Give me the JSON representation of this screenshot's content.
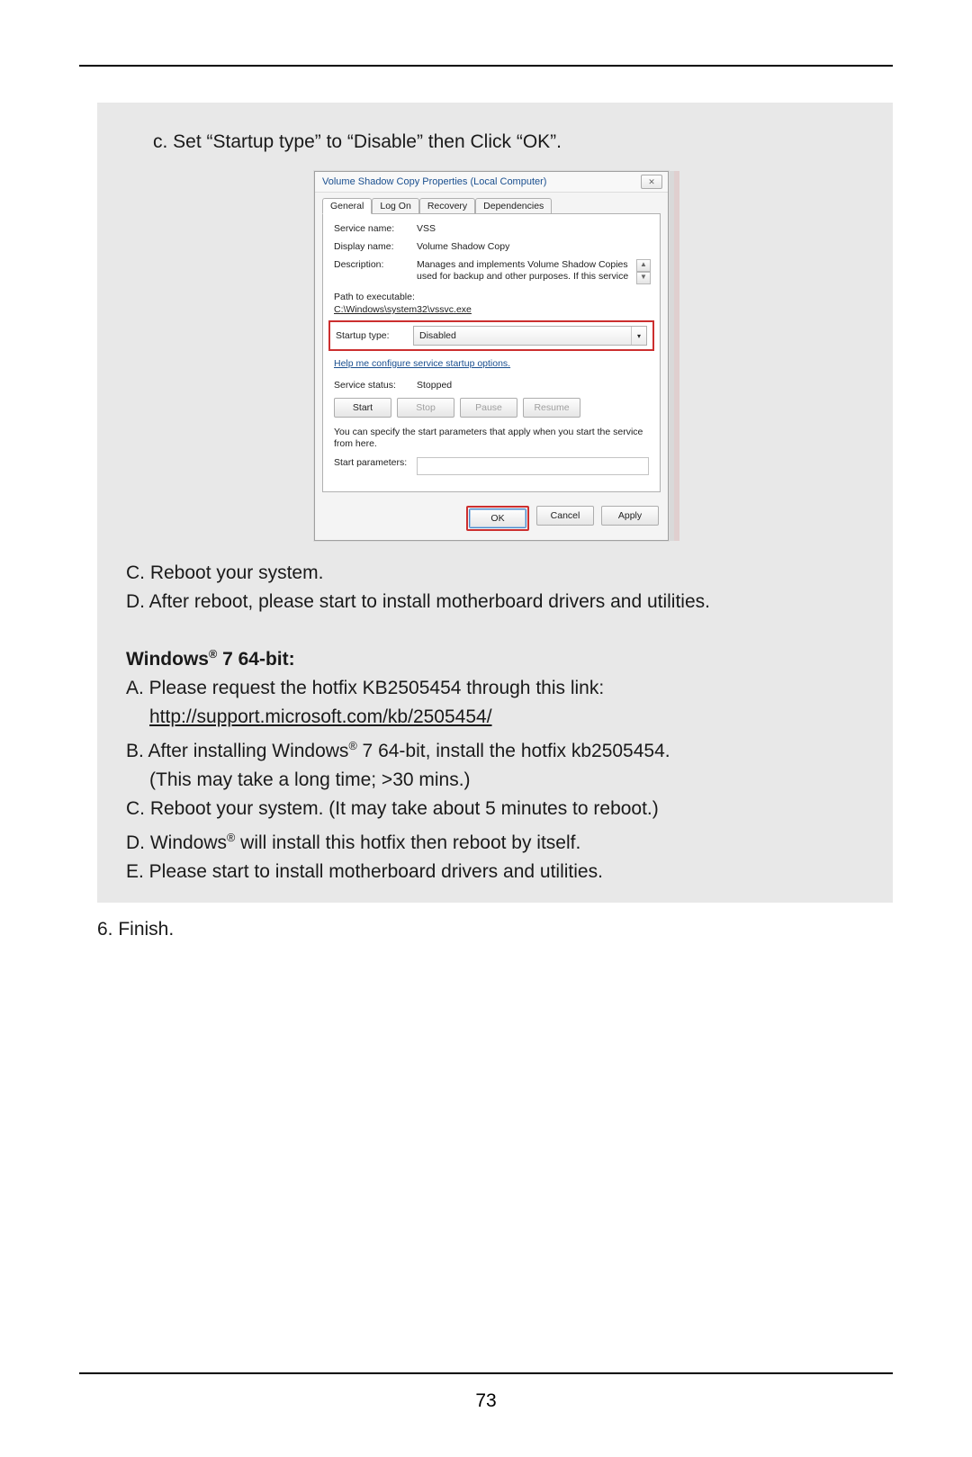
{
  "step_c_title": "c. Set “Startup type” to “Disable” then Click “OK”.",
  "dialog": {
    "title": "Volume Shadow Copy Properties (Local Computer)",
    "close_glyph": "✕",
    "tabs": [
      "General",
      "Log On",
      "Recovery",
      "Dependencies"
    ],
    "svc_name_lbl": "Service name:",
    "svc_name_val": "VSS",
    "disp_name_lbl": "Display name:",
    "disp_name_val": "Volume Shadow Copy",
    "desc_lbl": "Description:",
    "desc_val": "Manages and implements Volume Shadow Copies used for backup and other purposes. If this service",
    "up_glyph": "▲",
    "down_glyph": "▼",
    "path_lbl": "Path to executable:",
    "path_val": "C:\\Windows\\system32\\vssvc.exe",
    "startup_lbl": "Startup type:",
    "startup_val": "Disabled",
    "dd_glyph": "▾",
    "help_link": "Help me configure service startup options.",
    "status_lbl": "Service status:",
    "status_val": "Stopped",
    "btn_start": "Start",
    "btn_stop": "Stop",
    "btn_pause": "Pause",
    "btn_resume": "Resume",
    "note": "You can specify the start parameters that apply when you start the service from here.",
    "params_lbl": "Start parameters:",
    "btn_ok": "OK",
    "btn_cancel": "Cancel",
    "btn_apply": "Apply"
  },
  "post_lines": {
    "c": "C. Reboot your system.",
    "d": "D. After reboot, please start to install motherboard drivers and utilities."
  },
  "win7_heading_prefix": "Windows",
  "win7_heading_suffix": " 7 64-bit:",
  "win7": {
    "a": "A. Please request the hotfix KB2505454 through this link:",
    "a_link": "http://support.microsoft.com/kb/2505454/",
    "b1_pre": "B. After installing Windows",
    "b1_post": " 7 64-bit, install the hotfix kb2505454.",
    "b2": "(This may take a long time; >30 mins.)",
    "c": "C. Reboot your system. (It may take about 5 minutes to reboot.)",
    "d_pre": "D. Windows",
    "d_post": " will install this hotfix then reboot by itself.",
    "e": "E. Please start to install motherboard drivers and utilities."
  },
  "finish": "6. Finish.",
  "page_number": "73",
  "reg_mark": "®"
}
